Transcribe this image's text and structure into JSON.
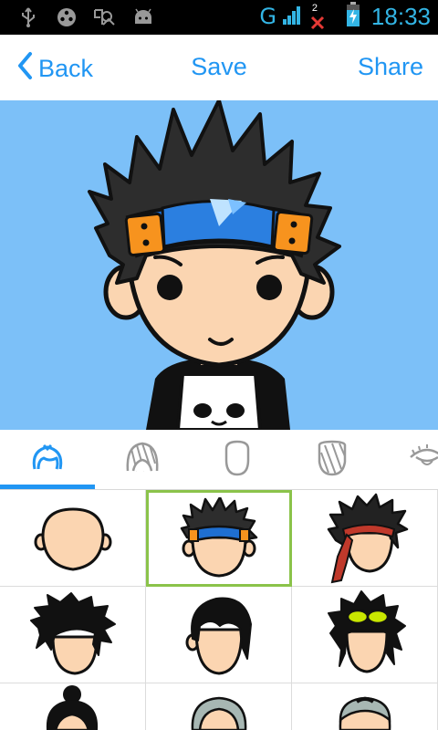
{
  "status_bar": {
    "network": "G",
    "notification_count": "2",
    "time": "18:33",
    "icons": [
      "usb-icon",
      "media-icon",
      "app-icon",
      "android-icon"
    ]
  },
  "action_bar": {
    "back_label": "Back",
    "save_label": "Save",
    "share_label": "Share",
    "accent_color": "#2196f3"
  },
  "preview": {
    "background_color": "#7cc0f8"
  },
  "category_tabs": [
    {
      "icon": "hair-icon",
      "selected": true
    },
    {
      "icon": "hair-striped-icon",
      "selected": false
    },
    {
      "icon": "face-shape-icon",
      "selected": false
    },
    {
      "icon": "beard-icon",
      "selected": false
    },
    {
      "icon": "eye-icon",
      "selected": false
    }
  ],
  "hair_options": [
    {
      "name": "bald",
      "selected": false
    },
    {
      "name": "spiky-headband",
      "selected": true
    },
    {
      "name": "messy-bandana",
      "selected": false
    },
    {
      "name": "wild-black",
      "selected": false
    },
    {
      "name": "side-part",
      "selected": false
    },
    {
      "name": "long-goggles",
      "selected": false
    },
    {
      "name": "bun",
      "selected": false
    },
    {
      "name": "gray-receding",
      "selected": false
    },
    {
      "name": "gray-short",
      "selected": false
    }
  ]
}
